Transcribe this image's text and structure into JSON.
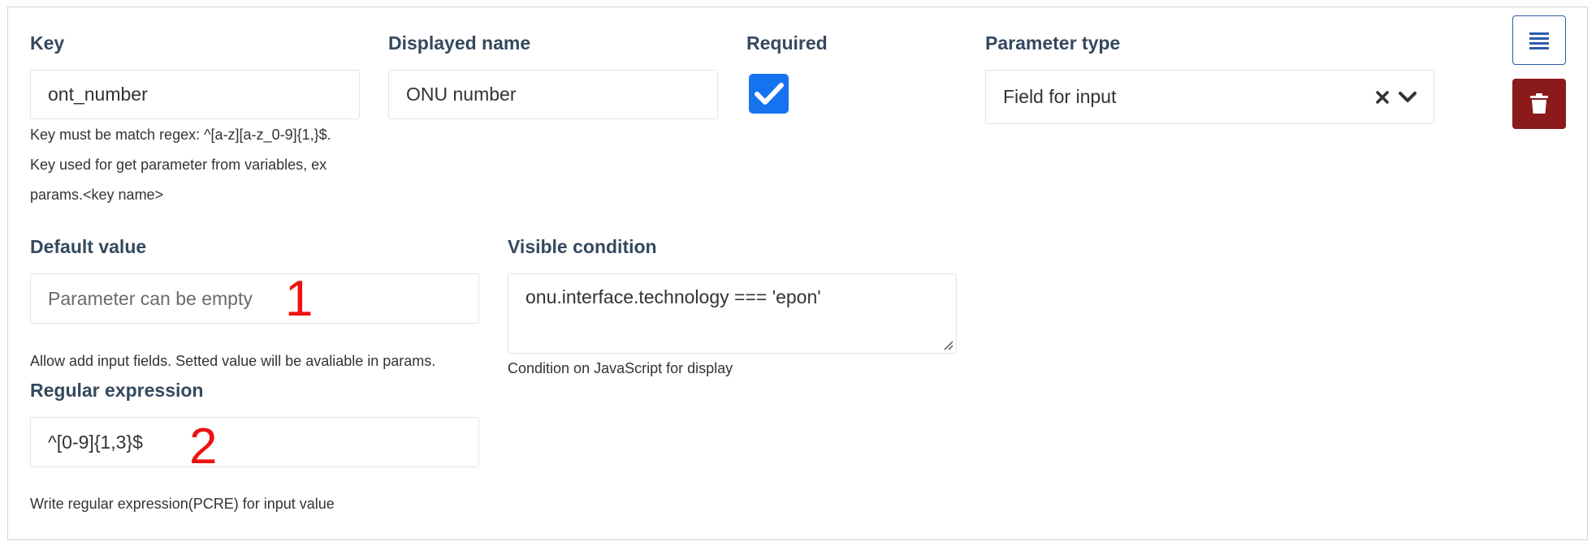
{
  "fields": {
    "key": {
      "label": "Key",
      "value": "ont_number",
      "help": [
        "Key must be match regex: ^[a-z][a-z_0-9]{1,}$.",
        "Key used for get parameter from variables, ex",
        "params.<key name>"
      ]
    },
    "displayed_name": {
      "label": "Displayed name",
      "value": "ONU number"
    },
    "required": {
      "label": "Required",
      "checked": true
    },
    "parameter_type": {
      "label": "Parameter type",
      "value": "Field for input"
    },
    "default_value": {
      "label": "Default value",
      "placeholder": "Parameter can be empty",
      "help": "Allow add input fields. Setted value will be avaliable in params."
    },
    "visible_condition": {
      "label": "Visible condition",
      "value": "onu.interface.technology === 'epon'",
      "help": "Condition on JavaScript for display"
    },
    "regular_expression": {
      "label": "Regular expression",
      "value": "^[0-9]{1,3}$",
      "help": "Write regular expression(PCRE) for input value"
    }
  },
  "annotations": {
    "marker1": "1",
    "marker2": "2"
  },
  "buttons": {
    "list": "list-icon",
    "delete": "trash-icon"
  },
  "colors": {
    "checkbox": "#1673f0",
    "delete": "#8b1a1a",
    "label": "#34495e",
    "marker": "#ee1111"
  }
}
